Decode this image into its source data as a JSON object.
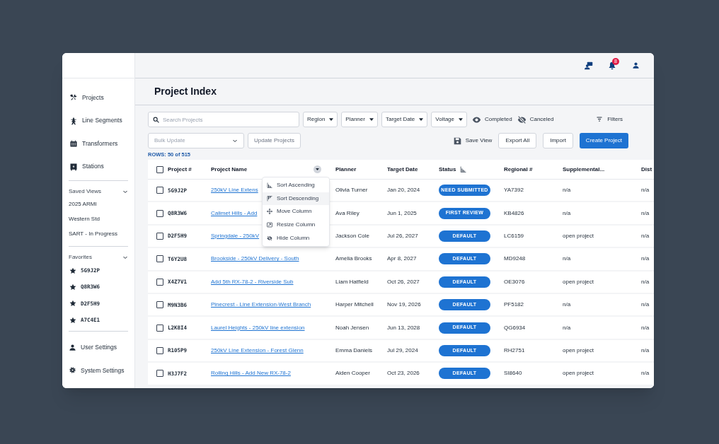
{
  "topbar": {
    "notification_count": "8"
  },
  "sidebar": {
    "nav": [
      {
        "label": "Projects"
      },
      {
        "label": "Line Segments"
      },
      {
        "label": "Transformers"
      },
      {
        "label": "Stations"
      }
    ],
    "saved_views": {
      "title": "Saved Views",
      "expanded": true,
      "items": [
        "2025 ARMI",
        "Western Std",
        "SART - In Progress"
      ]
    },
    "favorites": {
      "title": "Favorites",
      "expanded": true,
      "items": [
        "5G9J2P",
        "Q8R3W6",
        "D2F5H9",
        "A7C4E1"
      ]
    },
    "settings": [
      {
        "label": "User Settings"
      },
      {
        "label": "System Settings"
      }
    ]
  },
  "page_title": "Project Index",
  "filters": {
    "search_placeholder": "Search Projects",
    "dropdowns": [
      "Region",
      "Planner",
      "Target Date",
      "Voltage"
    ],
    "toggles": [
      {
        "label": "Completed",
        "visible": true
      },
      {
        "label": "Canceled",
        "visible": false
      }
    ],
    "filters_button": "Filters"
  },
  "actions": {
    "bulk_update_placeholder": "Bulk Update",
    "update_button": "Update Projects",
    "save_view": "Save View",
    "export_button": "Export All",
    "import_button": "Import",
    "create_button": "Create Project"
  },
  "rows_count": "ROWS: 50 of 515",
  "table": {
    "all_selected": false,
    "columns": [
      {
        "label": "Project #",
        "sort_icon": false,
        "menu_button": false
      },
      {
        "label": "Project Name",
        "sort_icon": false,
        "menu_button": true
      },
      {
        "label": "Planner",
        "sort_icon": false,
        "menu_button": false
      },
      {
        "label": "Target Date",
        "sort_icon": false,
        "menu_button": false
      },
      {
        "label": "Status",
        "sort_icon": true,
        "menu_button": false
      },
      {
        "label": "Regional #",
        "sort_icon": false,
        "menu_button": false
      },
      {
        "label": "Supplemental...",
        "sort_icon": false,
        "menu_button": false
      },
      {
        "label": "Dist"
      }
    ],
    "rows": [
      {
        "checked": false,
        "id": "5G9J2P",
        "name": "250kV Line Extens",
        "planner": "Olivia Turner",
        "date": "Jan 20, 2024",
        "status": "NEED SUBMITTED",
        "regional": "YA7392",
        "supplemental": "n/a",
        "dist": "n/a"
      },
      {
        "checked": false,
        "id": "Q8R3W6",
        "name": "Calimet Hills - Add",
        "planner": "Ava Riley",
        "date": "Jun 1, 2025",
        "status": "FIRST REVIEW",
        "regional": "KB4826",
        "supplemental": "n/a",
        "dist": "n/a"
      },
      {
        "checked": false,
        "id": "D2F5H9",
        "name": "Springdale - 250kV",
        "planner": "Jackson Cole",
        "date": "Jul 26, 2027",
        "status": "DEFAULT",
        "regional": "LC6159",
        "supplemental": "open project",
        "dist": "n/a"
      },
      {
        "checked": false,
        "id": "T6Y2U8",
        "name": "Brookside - 250kV Delivery - South",
        "planner": "Amelia Brooks",
        "date": "Apr 8, 2027",
        "status": "DEFAULT",
        "regional": "MD9248",
        "supplemental": "n/a",
        "dist": "n/a"
      },
      {
        "checked": false,
        "id": "X4Z7V1",
        "name": "Add 5th RX-78-2 - Riverside Sub",
        "planner": "Liam Hatfield",
        "date": "Oct 26, 2027",
        "status": "DEFAULT",
        "regional": "OE3076",
        "supplemental": "open project",
        "dist": "n/a"
      },
      {
        "checked": false,
        "id": "M9N3B6",
        "name": "Pinecrest - Line Extension-West Branch",
        "planner": "Harper Mitchell",
        "date": "Nov 19, 2026",
        "status": "DEFAULT",
        "regional": "PF5182",
        "supplemental": "n/a",
        "dist": "n/a"
      },
      {
        "checked": false,
        "id": "L2K8I4",
        "name": "Laurel Heights - 250kV line extension",
        "planner": "Noah Jensen",
        "date": "Jun 13, 2028",
        "status": "DEFAULT",
        "regional": "QG6934",
        "supplemental": "n/a",
        "dist": "n/a"
      },
      {
        "checked": false,
        "id": "R105P9",
        "name": "250kV Line Extension - Forest Glenn",
        "planner": "Emma Daniels",
        "date": "Jul 29, 2024",
        "status": "DEFAULT",
        "regional": "RH2751",
        "supplemental": "open project",
        "dist": "n/a"
      },
      {
        "checked": false,
        "id": "H3J7F2",
        "name": "Rolling Hills - Add New RX-78-2",
        "planner": "Aiden Cooper",
        "date": "Oct 23, 2026",
        "status": "DEFAULT",
        "regional": "SI8640",
        "supplemental": "open project",
        "dist": "n/a"
      }
    ]
  },
  "column_menu": {
    "items": [
      {
        "label": "Sort Ascending",
        "highlighted": false
      },
      {
        "label": "Sort Descending",
        "highlighted": true
      },
      {
        "label": "Move Column",
        "highlighted": false
      },
      {
        "label": "Resize Column",
        "highlighted": false
      },
      {
        "label": "Hide Column",
        "highlighted": false
      }
    ]
  }
}
